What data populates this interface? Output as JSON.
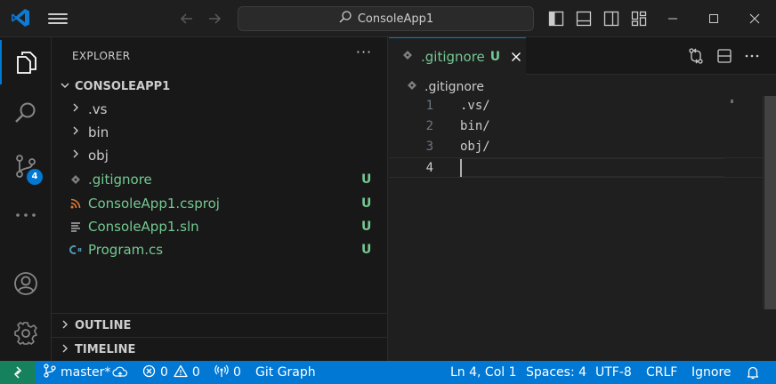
{
  "titlebar": {
    "search_text": "ConsoleApp1",
    "icons": [
      "vscode-logo-icon",
      "menu-icon",
      "back-arrow-icon",
      "forward-arrow-icon",
      "search-icon",
      "toggle-primary-sidebar-icon",
      "toggle-panel-icon",
      "toggle-secondary-sidebar-icon",
      "customize-layout-icon",
      "minimize-icon",
      "maximize-icon",
      "close-icon"
    ]
  },
  "activitybar": {
    "items": [
      "explorer-icon",
      "search-icon",
      "source-control-icon",
      "more-icon",
      "account-icon",
      "settings-gear-icon"
    ],
    "source_control_badge": "4"
  },
  "sidebar": {
    "title": "EXPLORER",
    "more": "···",
    "folder": "CONSOLEAPP1",
    "items": [
      {
        "name": ".vs",
        "kind": "folder",
        "status": ""
      },
      {
        "name": "bin",
        "kind": "folder",
        "status": ""
      },
      {
        "name": "obj",
        "kind": "folder",
        "status": ""
      },
      {
        "name": ".gitignore",
        "kind": "file",
        "status": "U"
      },
      {
        "name": "ConsoleApp1.csproj",
        "kind": "file",
        "status": "U"
      },
      {
        "name": "ConsoleApp1.sln",
        "kind": "file",
        "status": "U"
      },
      {
        "name": "Program.cs",
        "kind": "file",
        "status": "U"
      }
    ],
    "outline_label": "OUTLINE",
    "timeline_label": "TIMELINE"
  },
  "editor": {
    "tab": {
      "name": ".gitignore",
      "status": "U"
    },
    "breadcrumb": ".gitignore",
    "lines": [
      {
        "num": "1",
        "text": ".vs/"
      },
      {
        "num": "2",
        "text": "bin/"
      },
      {
        "num": "3",
        "text": "obj/"
      },
      {
        "num": "4",
        "text": ""
      }
    ]
  },
  "statusbar": {
    "branch": "master*",
    "errors": "0",
    "warnings": "0",
    "ports": "0",
    "git_graph": "Git Graph",
    "position": "Ln 4, Col 1",
    "spaces": "Spaces: 4",
    "encoding": "UTF-8",
    "eol": "CRLF",
    "language": "Ignore"
  },
  "colors": {
    "accent": "#0078d4",
    "untracked": "#73c991",
    "remote": "#16825d",
    "background": "#1f1f1f",
    "sidebar": "#181818"
  }
}
